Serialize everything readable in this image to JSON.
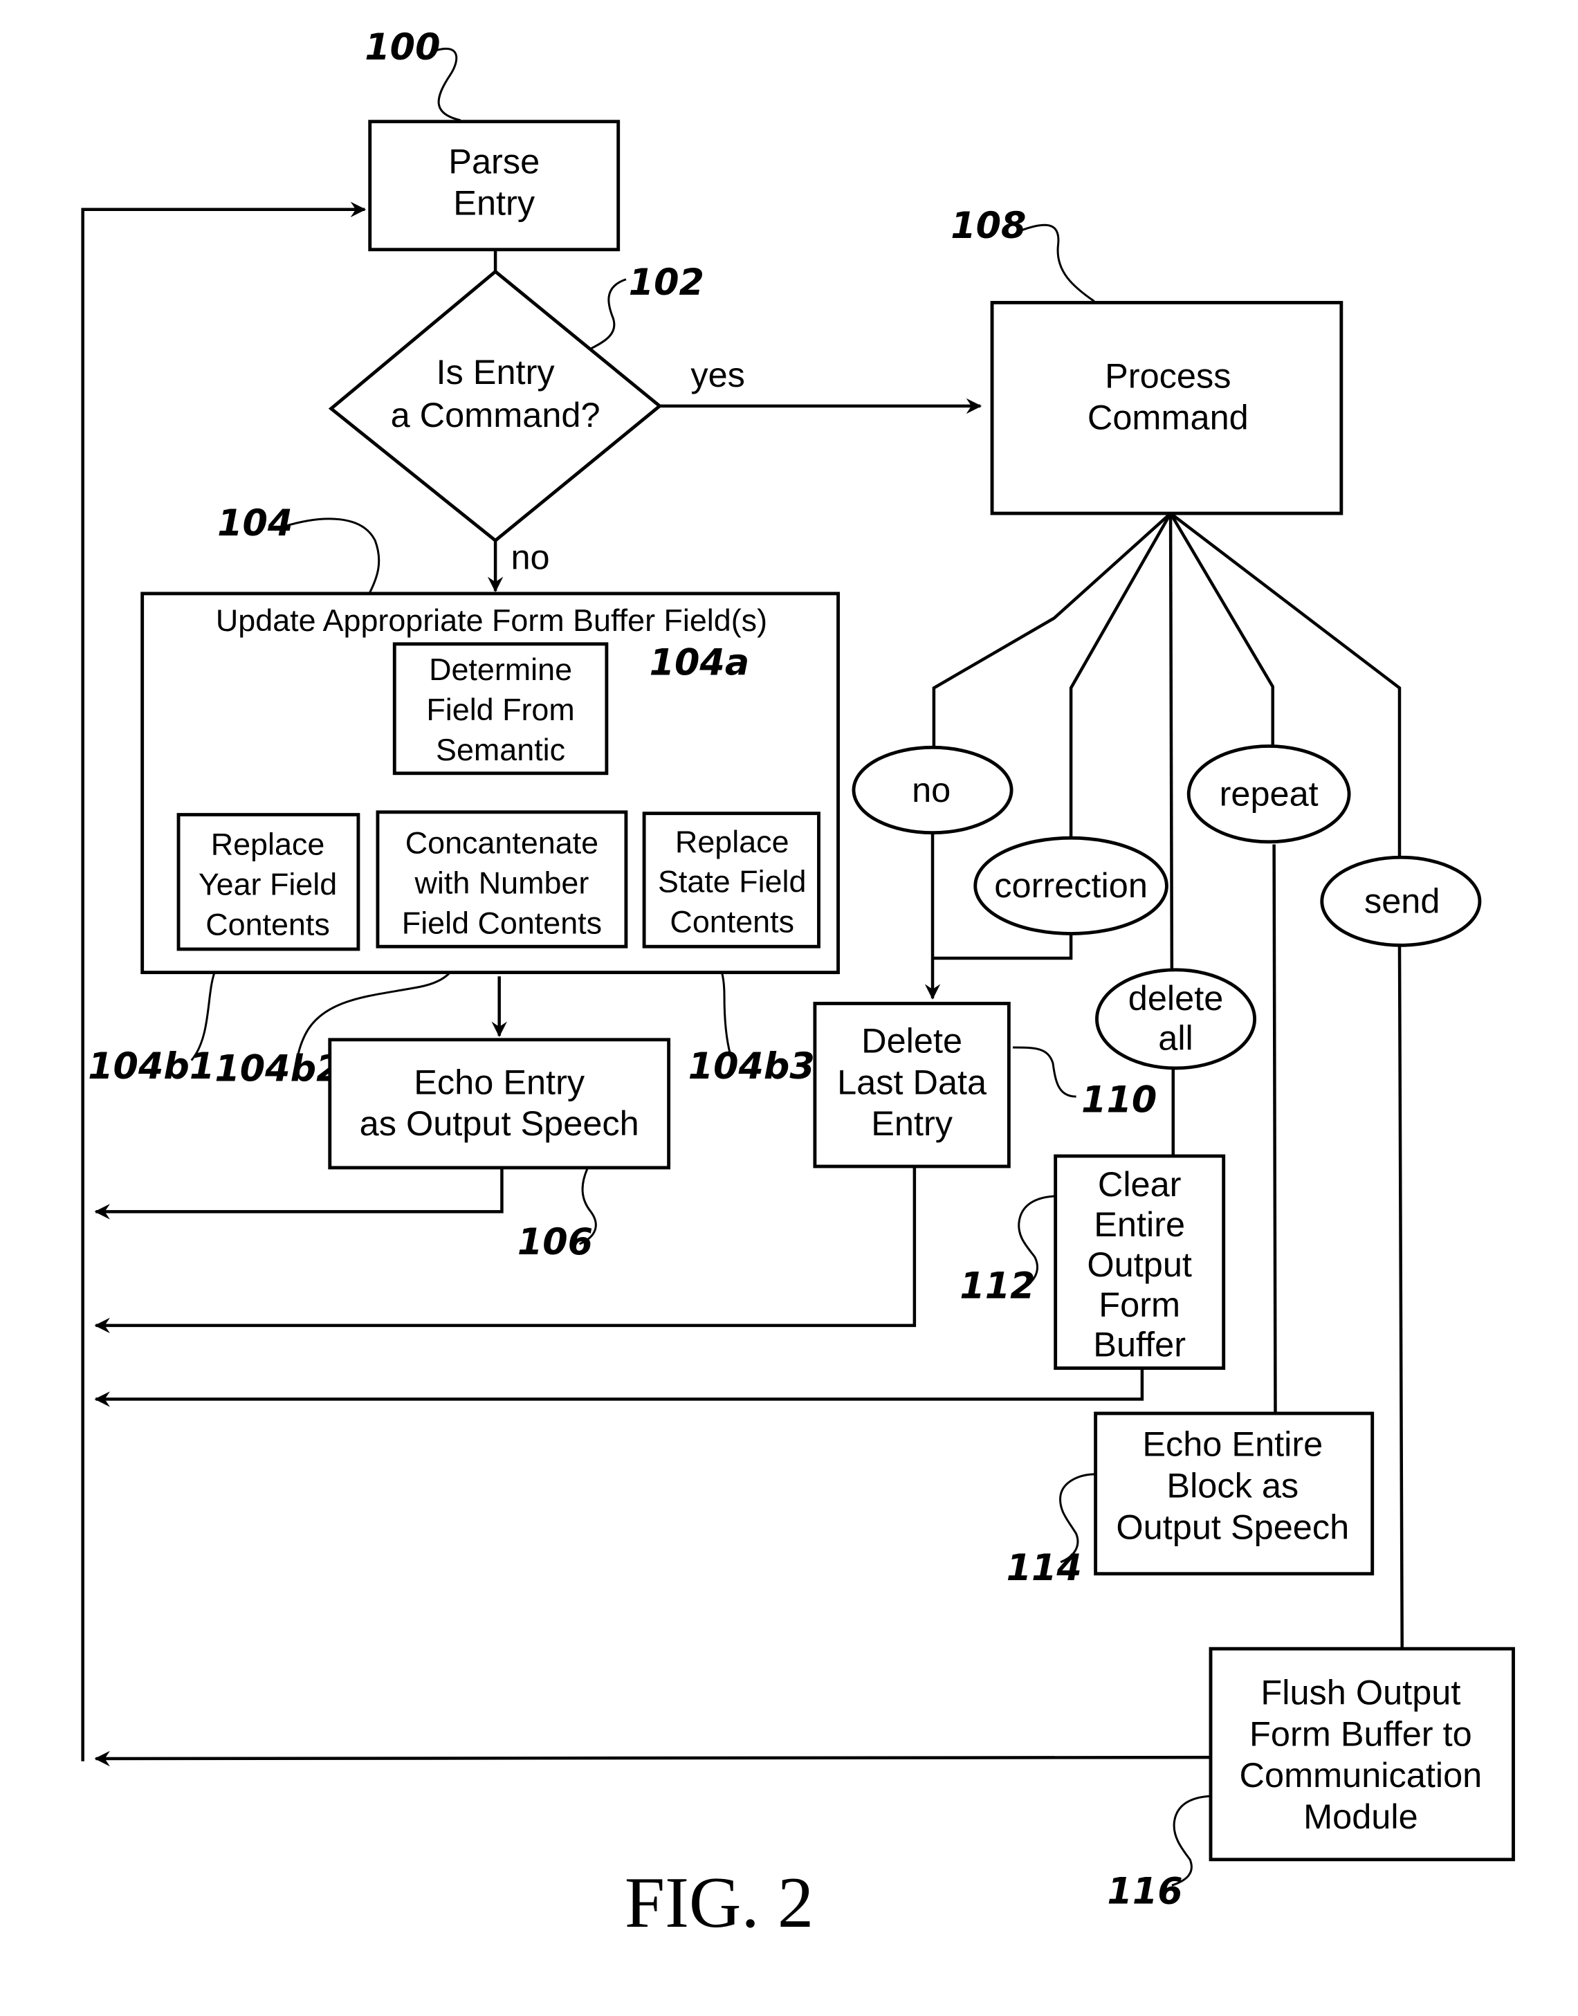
{
  "figure": {
    "caption": "FIG. 2",
    "ink_color": "#000000",
    "background_color": "#ffffff"
  },
  "nodes": {
    "parse_entry": {
      "ref": "100",
      "lines": [
        "Parse",
        "Entry"
      ]
    },
    "decision": {
      "ref": "102",
      "lines": [
        "Is Entry",
        "a Command?"
      ],
      "yes_label": "yes",
      "no_label": "no"
    },
    "process_command": {
      "ref": "108",
      "lines": [
        "Process",
        "Command"
      ]
    },
    "update_form": {
      "ref": "104",
      "title": "Update Appropriate Form Buffer Field(s)"
    },
    "determine_field": {
      "ref": "104a",
      "lines": [
        "Determine",
        "Field From",
        "Semantic"
      ]
    },
    "replace_year": {
      "ref": "104b1",
      "lines": [
        "Replace",
        "Year Field",
        "Contents"
      ]
    },
    "concatenate_number": {
      "ref": "104b2",
      "lines": [
        "Concantenate",
        "with Number",
        "Field Contents"
      ]
    },
    "replace_state": {
      "ref": "104b3",
      "lines": [
        "Replace",
        "State Field",
        "Contents"
      ]
    },
    "echo_entry": {
      "ref": "106",
      "lines": [
        "Echo Entry",
        "as Output Speech"
      ]
    },
    "delete_last": {
      "ref": "110",
      "lines": [
        "Delete",
        "Last Data",
        "Entry"
      ]
    },
    "clear_buffer": {
      "ref": "112",
      "lines": [
        "Clear",
        "Entire",
        "Output",
        "Form",
        "Buffer"
      ]
    },
    "echo_block": {
      "ref": "114",
      "lines": [
        "Echo Entire",
        "Block as",
        "Output Speech"
      ]
    },
    "flush_buffer": {
      "ref": "116",
      "lines": [
        "Flush Output",
        "Form Buffer to",
        "Communication",
        "Module"
      ]
    }
  },
  "commands": {
    "no": {
      "lines": [
        "no"
      ]
    },
    "correction": {
      "lines": [
        "correction"
      ]
    },
    "delete_all": {
      "lines": [
        "delete",
        "all"
      ]
    },
    "repeat": {
      "lines": [
        "repeat"
      ]
    },
    "send": {
      "lines": [
        "send"
      ]
    }
  }
}
